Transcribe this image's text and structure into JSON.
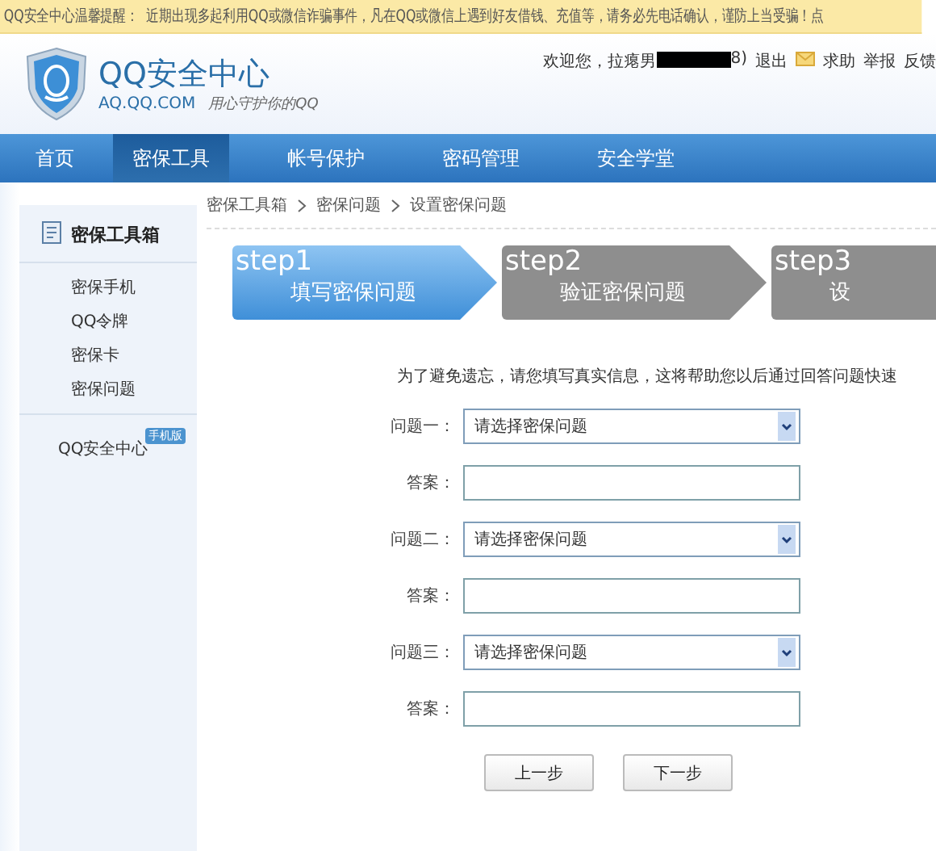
{
  "notice": {
    "title": "QQ安全中心温馨提醒：",
    "text": "近期出现多起利用QQ或微信诈骗事件，凡在QQ或微信上遇到好友借钱、充值等，请务必先电话确认，谨防上当受骗！点"
  },
  "header": {
    "logo_title": "QQ安全中心",
    "logo_url": "AQ.QQ.COM",
    "slogan": "用心守护你的QQ",
    "welcome": "欢迎您，拉瘪男",
    "welcome_tail": "8)",
    "logout": "退出",
    "links": [
      "求助",
      "举报",
      "反馈"
    ]
  },
  "nav": [
    {
      "label": "首页",
      "selected": false
    },
    {
      "label": "密保工具",
      "selected": true
    },
    {
      "label": "帐号保护",
      "selected": false
    },
    {
      "label": "密码管理",
      "selected": false
    },
    {
      "label": "安全学堂",
      "selected": false
    }
  ],
  "sidebar": {
    "title": "密保工具箱",
    "items": [
      "密保手机",
      "QQ令牌",
      "密保卡",
      "密保问题"
    ],
    "extra": {
      "label": "QQ安全中心",
      "badge": "手机版"
    }
  },
  "breadcrumb": [
    "密保工具箱",
    "密保问题",
    "设置密保问题"
  ],
  "steps": [
    {
      "label": "step1",
      "title": "填写密保问题",
      "selected": true
    },
    {
      "label": "step2",
      "title": "验证密保问题",
      "selected": false
    },
    {
      "label": "step3",
      "title": "设",
      "selected": false
    }
  ],
  "intro": "为了避免遗忘，请您填写真实信息，这将帮助您以后通过回答问题快速",
  "form": [
    {
      "kind": "select",
      "label": "问题一：",
      "value": "请选择密保问题"
    },
    {
      "kind": "input",
      "label": "答案："
    },
    {
      "kind": "select",
      "label": "问题二：",
      "value": "请选择密保问题"
    },
    {
      "kind": "input",
      "label": "答案："
    },
    {
      "kind": "select",
      "label": "问题三：",
      "value": "请选择密保问题"
    },
    {
      "kind": "input",
      "label": "答案："
    }
  ],
  "buttons": [
    "上一步",
    "下一步"
  ]
}
